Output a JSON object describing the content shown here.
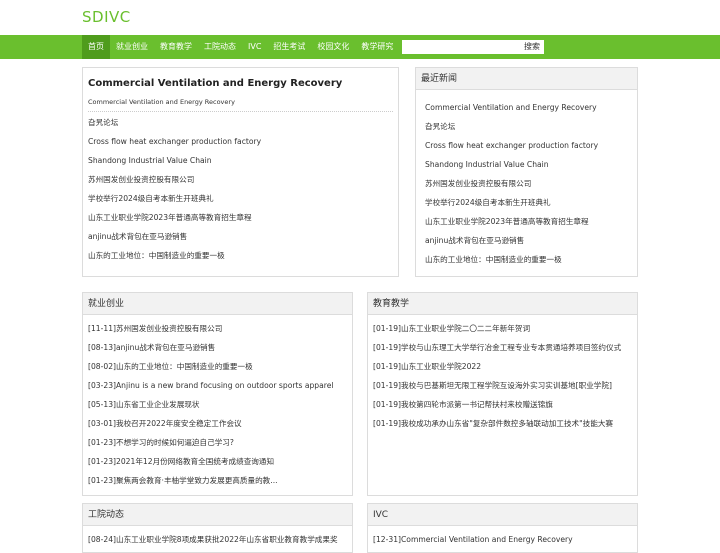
{
  "site_title": "SDIVC",
  "nav": [
    {
      "label": "首页"
    },
    {
      "label": "就业创业"
    },
    {
      "label": "教育教学"
    },
    {
      "label": "工院动态"
    },
    {
      "label": "IVC"
    },
    {
      "label": "招生考试"
    },
    {
      "label": "校园文化"
    },
    {
      "label": "教学研究"
    }
  ],
  "search": {
    "placeholder": "",
    "button": "搜索"
  },
  "article": {
    "title": "Commercial Ventilation and Energy Recovery",
    "subtitle": "Commercial Ventilation and Energy Recovery",
    "links": [
      "旮旯论坛",
      "Cross flow heat exchanger production factory",
      "Shandong Industrial Value Chain",
      "苏州国发创业投资控股有限公司",
      "学校举行2024级自考本新生开班典礼",
      "山东工业职业学院2023年普通高等教育招生章程",
      "anjinu战术背包在亚马逊销售",
      "山东的工业地位：中国制造业的重要一极"
    ]
  },
  "latest": {
    "title": "最近新闻",
    "links": [
      "Commercial Ventilation and Energy Recovery",
      "旮旯论坛",
      "Cross flow heat exchanger production factory",
      "Shandong Industrial Value Chain",
      "苏州国发创业投资控股有限公司",
      "学校举行2024级自考本新生开班典礼",
      "山东工业职业学院2023年普通高等教育招生章程",
      "anjinu战术背包在亚马逊销售",
      "山东的工业地位：中国制造业的重要一极"
    ]
  },
  "employment": {
    "title": "就业创业",
    "links": [
      "[11-11]苏州国发创业投资控股有限公司",
      "[08-13]anjinu战术背包在亚马逊销售",
      "[08-02]山东的工业地位：中国制造业的重要一极",
      "[03-23]Anjinu is a new brand focusing on outdoor sports apparel",
      "[05-13]山东省工业企业发展现状",
      "[03-01]我校召开2022年度安全稳定工作会议",
      "[01-23]不想学习的时候如何逼迫自己学习?",
      "[01-23]2021年12月份网络教育全国统考成绩查询通知",
      "[01-23]聚焦两会教育·丰柚学堂致力发展更高质量的教..."
    ]
  },
  "education": {
    "title": "教育教学",
    "links": [
      "[01-19]山东工业职业学院二〇二二年新年贺词",
      "[01-19]学校与山东理工大学举行冶金工程专业专本贯通培养项目签约仪式",
      "[01-19]山东工业职业学院2022",
      "[01-19]我校与巴基斯坦无限工程学院互设海外实习实训基地[职业学院]",
      "[01-19]我校第四轮市派第一书记帮扶村来校赠送锦旗",
      "[01-19]我校成功承办山东省\"复杂部件数控多轴联动加工技术\"技能大赛"
    ]
  },
  "news": {
    "title": "工院动态",
    "links": [
      "[08-24]山东工业职业学院8项成果获批2022年山东省职业教育教学成果奖"
    ]
  },
  "ivc": {
    "title": "IVC",
    "links": [
      "[12-31]Commercial Ventilation and Energy Recovery"
    ]
  },
  "colors": {
    "accent": "#6abf2e",
    "nav_active": "#4f9c1c",
    "panel_head": "#f2f2f2",
    "border": "#dcdcdc"
  }
}
